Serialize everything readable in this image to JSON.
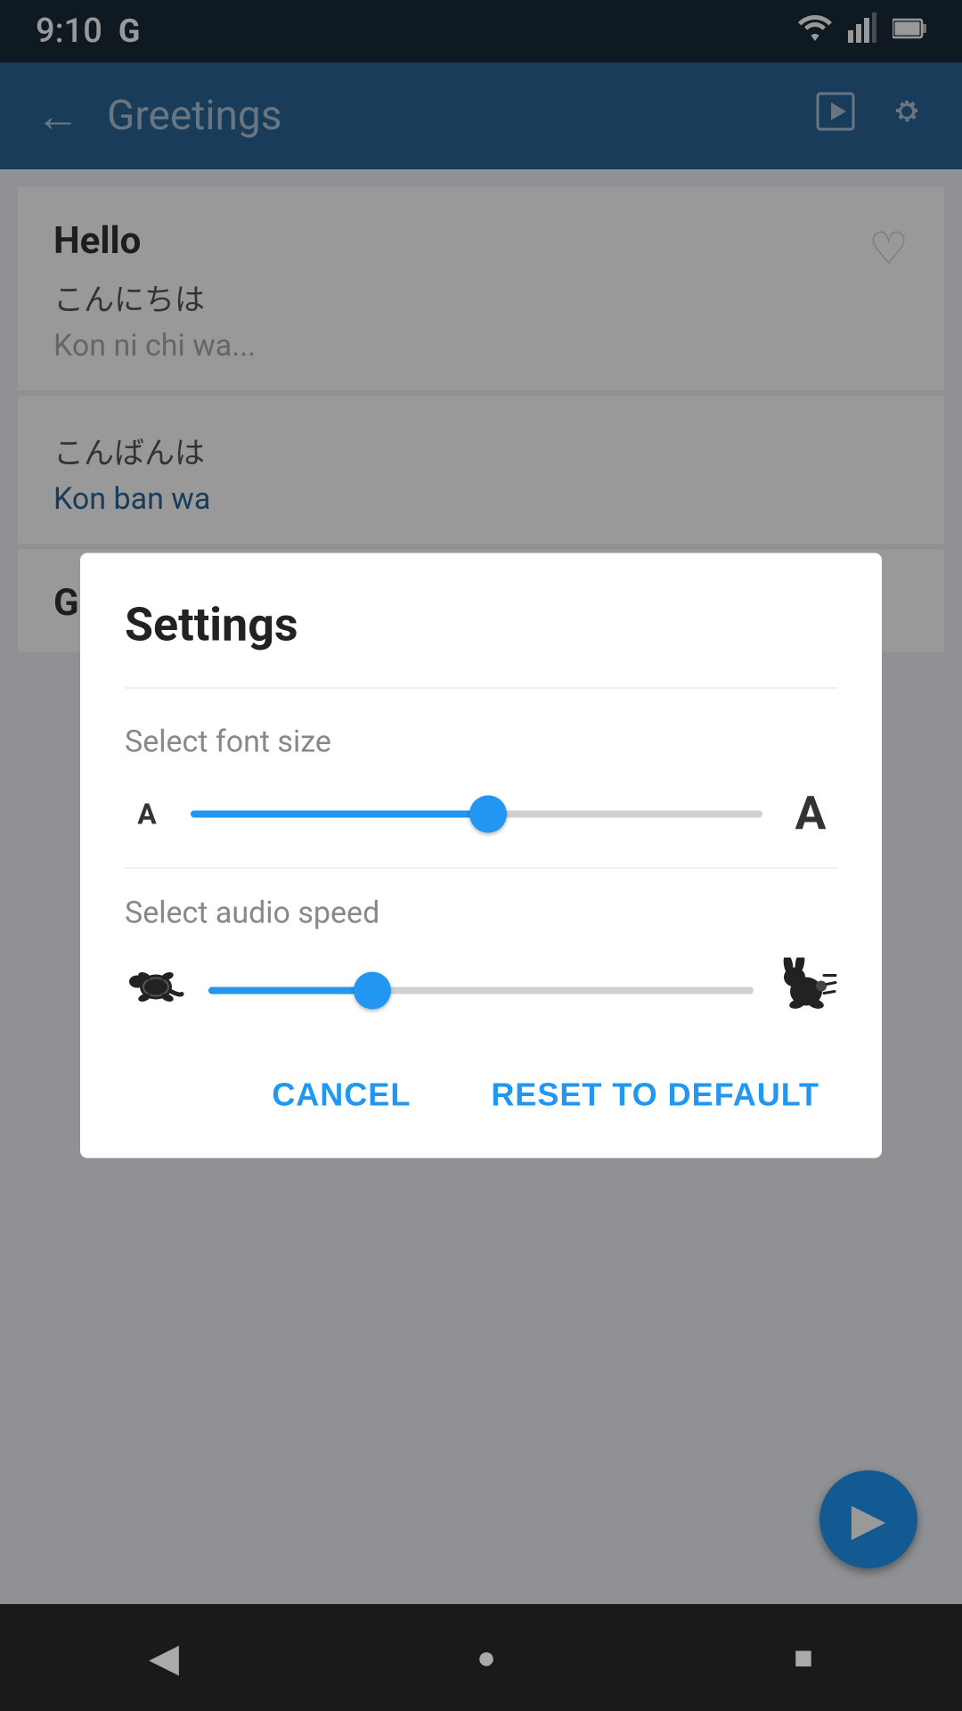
{
  "statusBar": {
    "time": "9:10",
    "google_label": "G"
  },
  "appBar": {
    "title": "Greetings",
    "back_label": "←",
    "play_icon": "▶",
    "settings_icon": "⚙"
  },
  "backgroundContent": {
    "card1": {
      "title": "Hello",
      "japanese": "こんにちは",
      "romaji_partial": "Kon ni chi wa"
    },
    "card2": {
      "japanese": "こんばんは",
      "romaji": "Kon ban wa"
    },
    "card3": {
      "title": "Goodnight"
    }
  },
  "dialog": {
    "title": "Settings",
    "fontSizeLabel": "Select font size",
    "fontSizeSmallLabel": "A",
    "fontSizeLargeLabel": "A",
    "fontSliderPercent": 52,
    "audioSpeedLabel": "Select audio speed",
    "audioSliderPercent": 30,
    "cancelButton": "CANCEL",
    "resetButton": "RESET TO DEFAULT"
  },
  "fab": {
    "icon": "▶"
  },
  "bottomNav": {
    "back": "◀",
    "home": "●",
    "recent": "■"
  }
}
